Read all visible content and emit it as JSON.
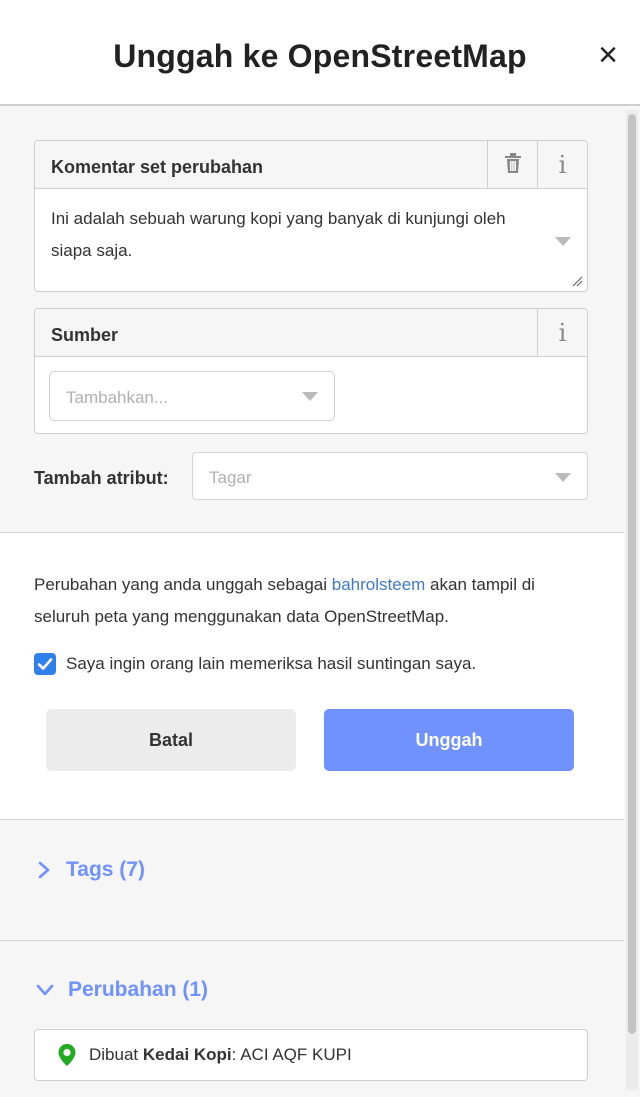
{
  "header": {
    "title": "Unggah ke OpenStreetMap",
    "close_icon": "×"
  },
  "comment": {
    "label": "Komentar set perubahan",
    "trash_icon": "trash-icon",
    "info_icon": "i",
    "value": "Ini adalah sebuah warung kopi yang banyak di kunjungi oleh siapa saja."
  },
  "source": {
    "label": "Sumber",
    "info_icon": "i",
    "placeholder": "Tambahkan..."
  },
  "attribute": {
    "label": "Tambah atribut:",
    "placeholder": "Tagar"
  },
  "message": {
    "before": "Perubahan yang anda unggah sebagai ",
    "user": "bahrolsteem",
    "after": " akan tampil di seluruh peta yang menggunakan data OpenStreetMap."
  },
  "review": {
    "checked": true,
    "label": "Saya ingin orang lain memeriksa hasil suntingan saya."
  },
  "buttons": {
    "cancel": "Batal",
    "upload": "Unggah"
  },
  "tags_section": {
    "label": "Tags (7)",
    "expanded": false
  },
  "changes_section": {
    "label": "Perubahan (1)",
    "expanded": true
  },
  "change_item": {
    "prefix": "Dibuat",
    "type": "Kedai Kopi",
    "separator": ":",
    "name": "ACI AQF KUPI"
  },
  "colors": {
    "accent": "#7092ff",
    "link": "#3e79c9",
    "checkbox": "#2f80ed",
    "pin": "#22aa22"
  }
}
